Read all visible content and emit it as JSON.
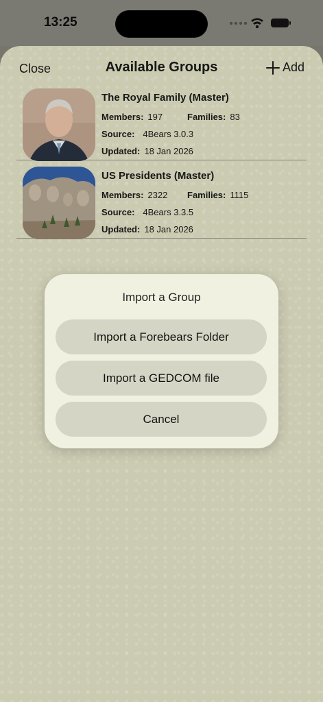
{
  "status_bar": {
    "time": "13:25"
  },
  "nav": {
    "close_label": "Close",
    "title": "Available Groups",
    "add_label": "Add"
  },
  "groups": [
    {
      "title": "The Royal Family (Master)",
      "members_label": "Members:",
      "members": "197",
      "families_label": "Families:",
      "families": "83",
      "source_label": "Source:",
      "source": "4Bears 3.0.3",
      "updated_label": "Updated:",
      "updated": "18 Jan 2026"
    },
    {
      "title": "US Presidents (Master)",
      "members_label": "Members:",
      "members": "2322",
      "families_label": "Families:",
      "families": "1115",
      "source_label": "Source:",
      "source": "4Bears 3.3.5",
      "updated_label": "Updated:",
      "updated": "18 Jan 2026"
    }
  ],
  "dialog": {
    "title": "Import a Group",
    "buttons": [
      "Import a Forebears Folder",
      "Import a GEDCOM file",
      "Cancel"
    ]
  }
}
